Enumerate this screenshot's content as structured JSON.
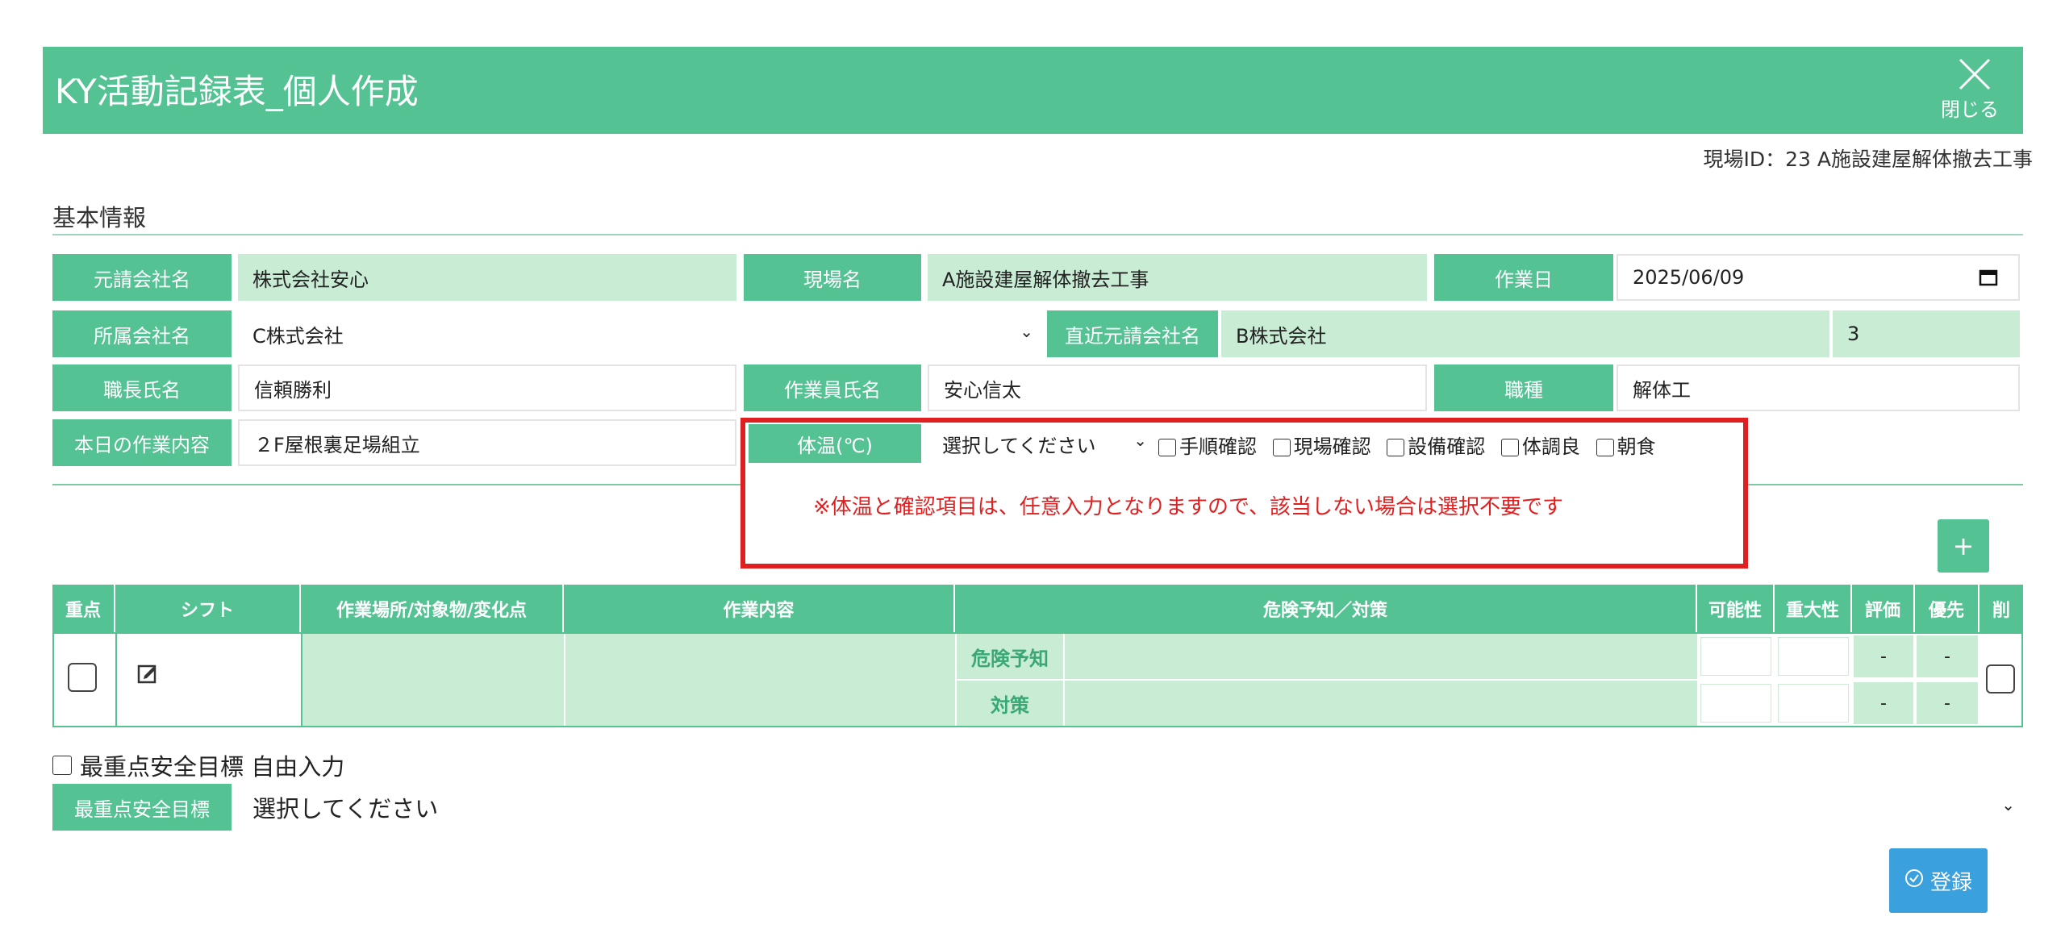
{
  "header": {
    "title": "KY活動記録表_個人作成",
    "close_label": "閉じる"
  },
  "site_id": "現場ID：23 A施設建屋解体撤去工事",
  "basic_info": {
    "title": "基本情報",
    "prime_contractor": {
      "label": "元請会社名",
      "value": "株式会社安心"
    },
    "site_name": {
      "label": "現場名",
      "value": "A施設建屋解体撤去工事"
    },
    "work_date": {
      "label": "作業日",
      "value": "2025/06/09"
    },
    "affiliation": {
      "label": "所属会社名",
      "value": "C株式会社"
    },
    "direct_contractor": {
      "label": "直近元請会社名",
      "value": "B株式会社"
    },
    "tier": "3",
    "foreman": {
      "label": "職長氏名",
      "value": "信頼勝利"
    },
    "worker": {
      "label": "作業員氏名",
      "value": "安心信太"
    },
    "job_type": {
      "label": "職種",
      "value": "解体工"
    },
    "today_work": {
      "label": "本日の作業内容",
      "value": "２F屋根裏足場組立"
    },
    "temperature": {
      "label": "体温(℃)",
      "value": "選択してください"
    },
    "checks": [
      "手順確認",
      "現場確認",
      "設備確認",
      "体調良",
      "朝食"
    ],
    "notice": "※体温と確認項目は、任意入力となりますので、該当しない場合は選択不要です"
  },
  "add_button": "+",
  "table": {
    "headers": [
      "重点",
      "シフト",
      "作業場所/対象物/変化点",
      "作業内容",
      "危険予知／対策",
      "可能性",
      "重大性",
      "評価",
      "優先",
      "削"
    ],
    "row": {
      "danger_label": "危険予知",
      "measure_label": "対策",
      "eval_top": "-",
      "priority_top": "-",
      "eval_bottom": "-",
      "priority_bottom": "-"
    }
  },
  "safety_goal": {
    "free_input_label": "最重点安全目標 自由入力",
    "label": "最重点安全目標",
    "value": "選択してください"
  },
  "register_button": "登録",
  "icons": [
    "close-icon",
    "calendar-icon",
    "chevron-down-icon",
    "edit-icon",
    "check-circle-icon"
  ]
}
